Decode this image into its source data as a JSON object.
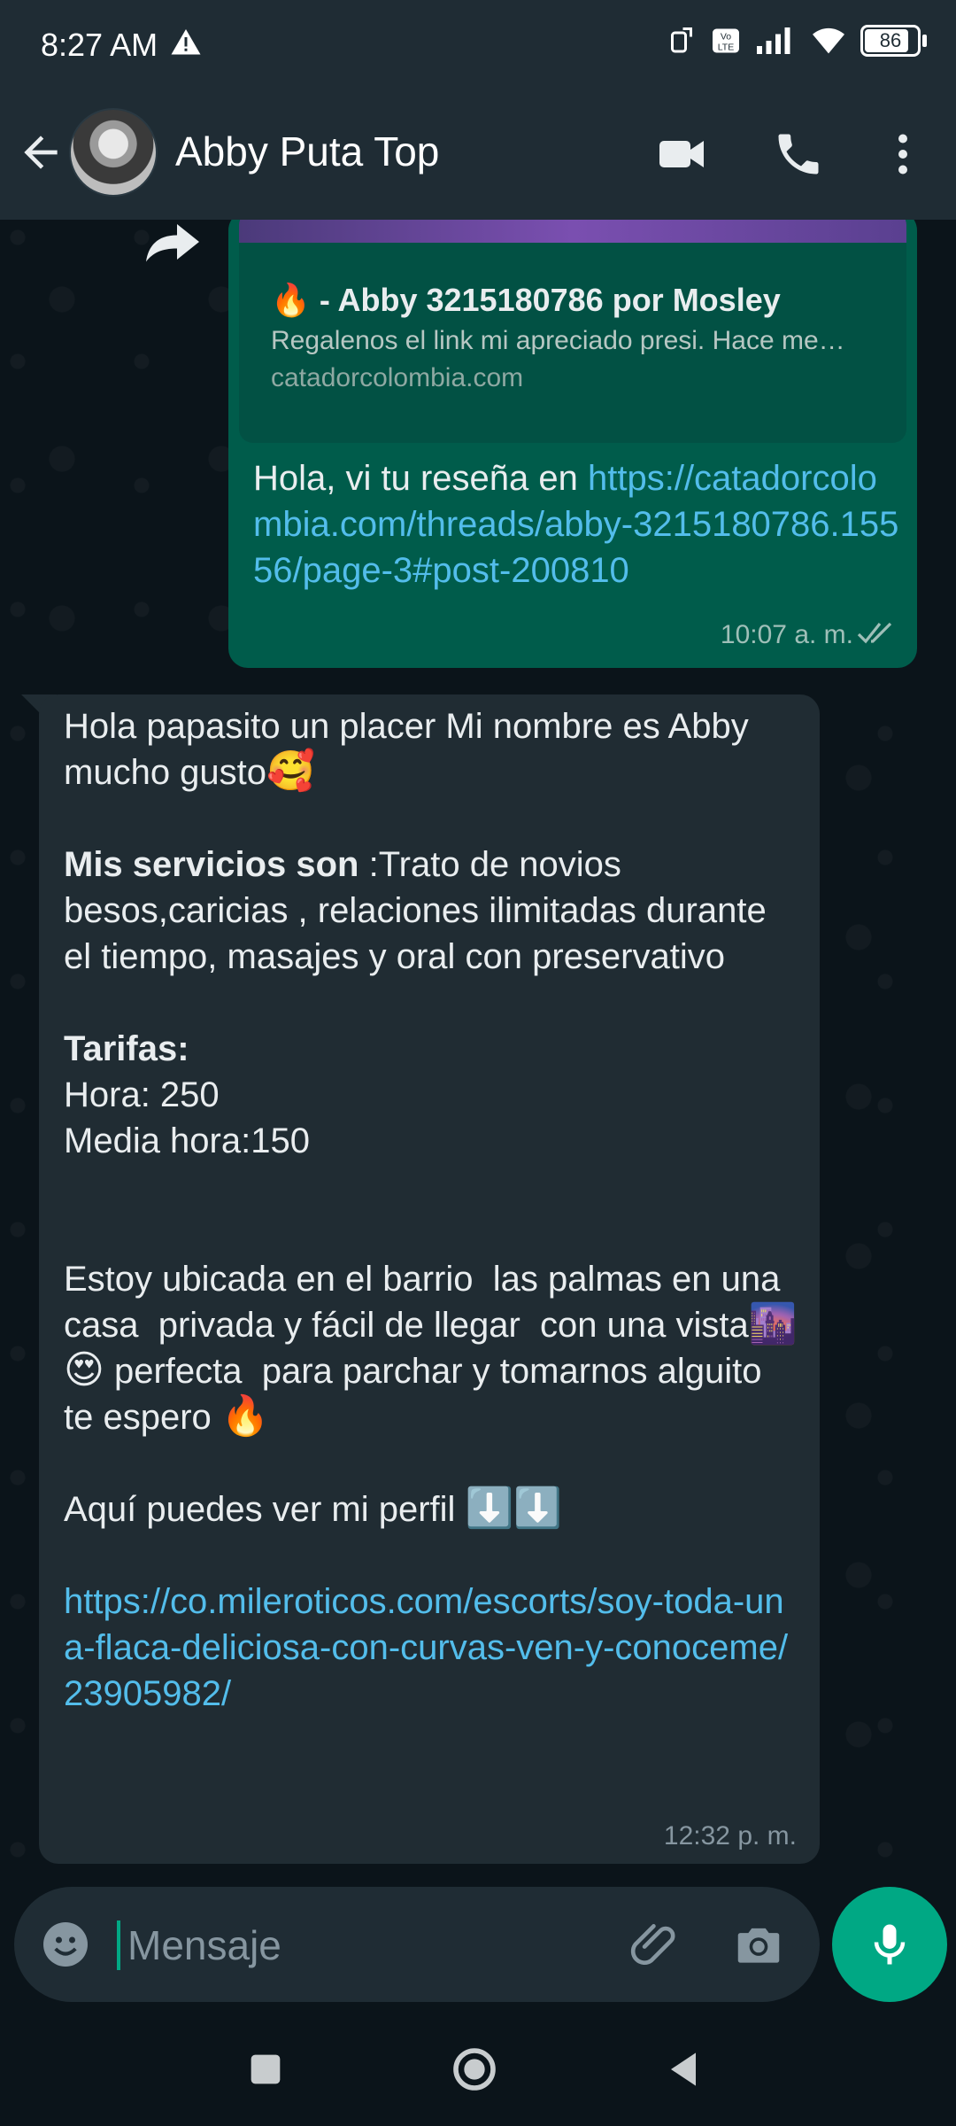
{
  "status_bar": {
    "time": "8:27 AM",
    "battery": "86",
    "battery_fraction": 0.86
  },
  "header": {
    "contact_name": "Abby Puta Top",
    "icons": [
      "back-arrow-icon",
      "avatar",
      "video-call-icon",
      "phone-call-icon",
      "more-options-icon"
    ]
  },
  "messages": {
    "outgoing": {
      "preview_title": "🔥 - Abby 3215180786 por Mosley",
      "preview_description": "Regalenos el link mi apreciado presi. Hace me…",
      "preview_domain": "catadorcolombia.com",
      "text_prefix": "Hola, vi tu reseña en ",
      "link": "https://catadorcolombia.com/threads/abby-3215180786.15556/page-3#post-200810",
      "time": "10:07 a. m."
    },
    "incoming": {
      "line_greeting": "Hola papasito un placer Mi nombre es Abby mucho gusto",
      "emoji_smile_hearts": "🥰",
      "services_label": "Mis servicios son",
      "services_text": " :Trato de novios besos,caricias , relaciones ilimitadas durante el tiempo, masajes y oral con preservativo",
      "rates_label": "Tarifas:",
      "rate_hour": "Hora: 250",
      "rate_half_hour": "Media hora:150",
      "location_text_1": "Estoy ubicada en el barrio  las palmas en una casa  privada y fácil de llegar  con una vista",
      "emoji_city": "🌆",
      "emoji_heart_eyes": "😍",
      "location_text_2": " perfecta  para parchar y tomarnos alguito te espero ",
      "emoji_fire": "🔥",
      "profile_text": "Aquí puedes ver mi perfil ",
      "emoji_arrows": "⬇️⬇️",
      "profile_link": "https://co.mileroticos.com/escorts/soy-toda-una-flaca-deliciosa-con-curvas-ven-y-conoceme/23905982/",
      "time": "12:32 p. m."
    }
  },
  "composer": {
    "placeholder": "Mensaje"
  },
  "colors": {
    "outgoing_bubble": "#005c4b",
    "incoming_bubble": "#202c33",
    "link": "#53bdeb",
    "accent": "#00a884"
  }
}
